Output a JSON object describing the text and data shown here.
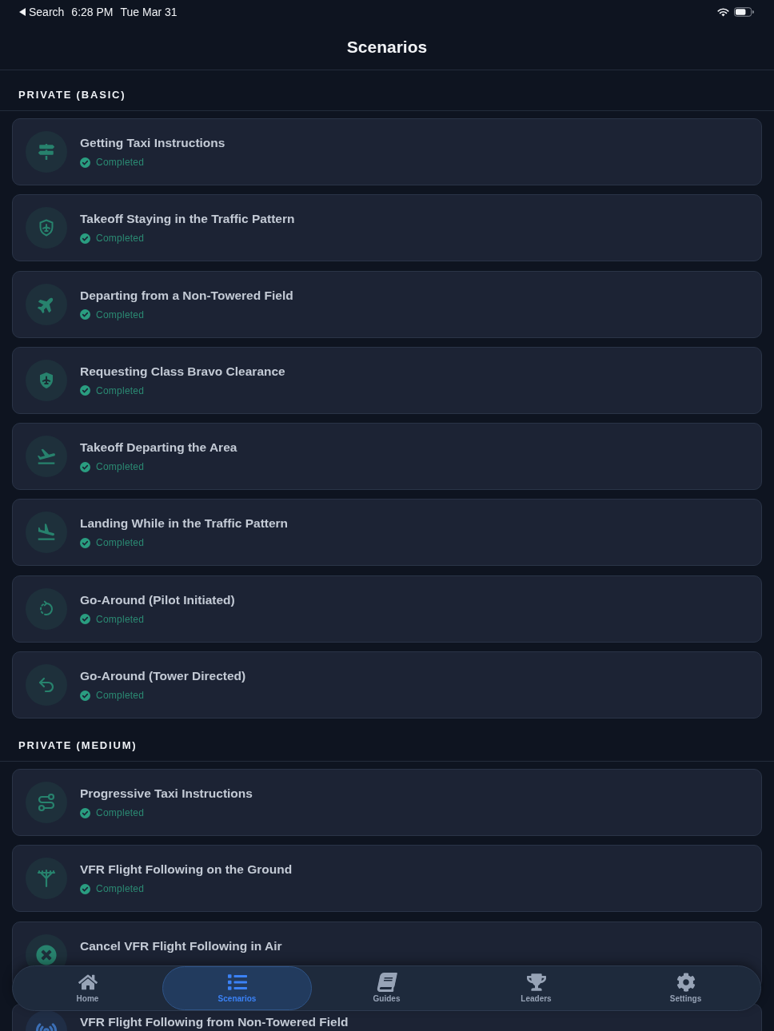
{
  "status_bar": {
    "back_label": "Search",
    "time": "6:28 PM",
    "date": "Tue Mar 31"
  },
  "header": {
    "title": "Scenarios"
  },
  "sections": [
    {
      "title": "PRIVATE (BASIC)",
      "items": [
        {
          "title": "Getting Taxi Instructions",
          "kind": "signpost",
          "color": "#27826d",
          "status": "Completed"
        },
        {
          "title": "Takeoff Staying in the Traffic Pattern",
          "kind": "shield",
          "color": "#27826d",
          "status": "Completed"
        },
        {
          "title": "Departing from a Non-Towered Field",
          "kind": "plane",
          "color": "#27826d",
          "status": "Completed"
        },
        {
          "title": "Requesting Class Bravo Clearance",
          "kind": "badge",
          "color": "#27826d",
          "status": "Completed"
        },
        {
          "title": "Takeoff Departing the Area",
          "kind": "takeoff",
          "color": "#27826d",
          "status": "Completed"
        },
        {
          "title": "Landing While in the Traffic Pattern",
          "kind": "landing",
          "color": "#27826d",
          "status": "Completed"
        },
        {
          "title": "Go-Around (Pilot Initiated)",
          "kind": "loop",
          "color": "#27826d",
          "status": "Completed"
        },
        {
          "title": "Go-Around (Tower Directed)",
          "kind": "undo",
          "color": "#27826d",
          "status": "Completed"
        }
      ]
    },
    {
      "title": "PRIVATE (MEDIUM)",
      "items": [
        {
          "title": "Progressive Taxi Instructions",
          "kind": "route",
          "color": "#27826d",
          "status": "Completed"
        },
        {
          "title": "VFR Flight Following on the Ground",
          "kind": "tower",
          "color": "#27826d",
          "status": "Completed"
        },
        {
          "title": "Cancel VFR Flight Following in Air",
          "kind": "cancel",
          "color": "#27826d"
        },
        {
          "title": "VFR Flight Following from Non-Towered Field",
          "kind": "radio",
          "color": "#3b6fb6"
        }
      ]
    }
  ],
  "tab_bar": [
    {
      "label": "Home",
      "kind": "home",
      "selected": false
    },
    {
      "label": "Scenarios",
      "kind": "list",
      "selected": true
    },
    {
      "label": "Guides",
      "kind": "book",
      "selected": false
    },
    {
      "label": "Leaders",
      "kind": "trophy",
      "selected": false
    },
    {
      "label": "Settings",
      "kind": "gear",
      "selected": false
    }
  ]
}
